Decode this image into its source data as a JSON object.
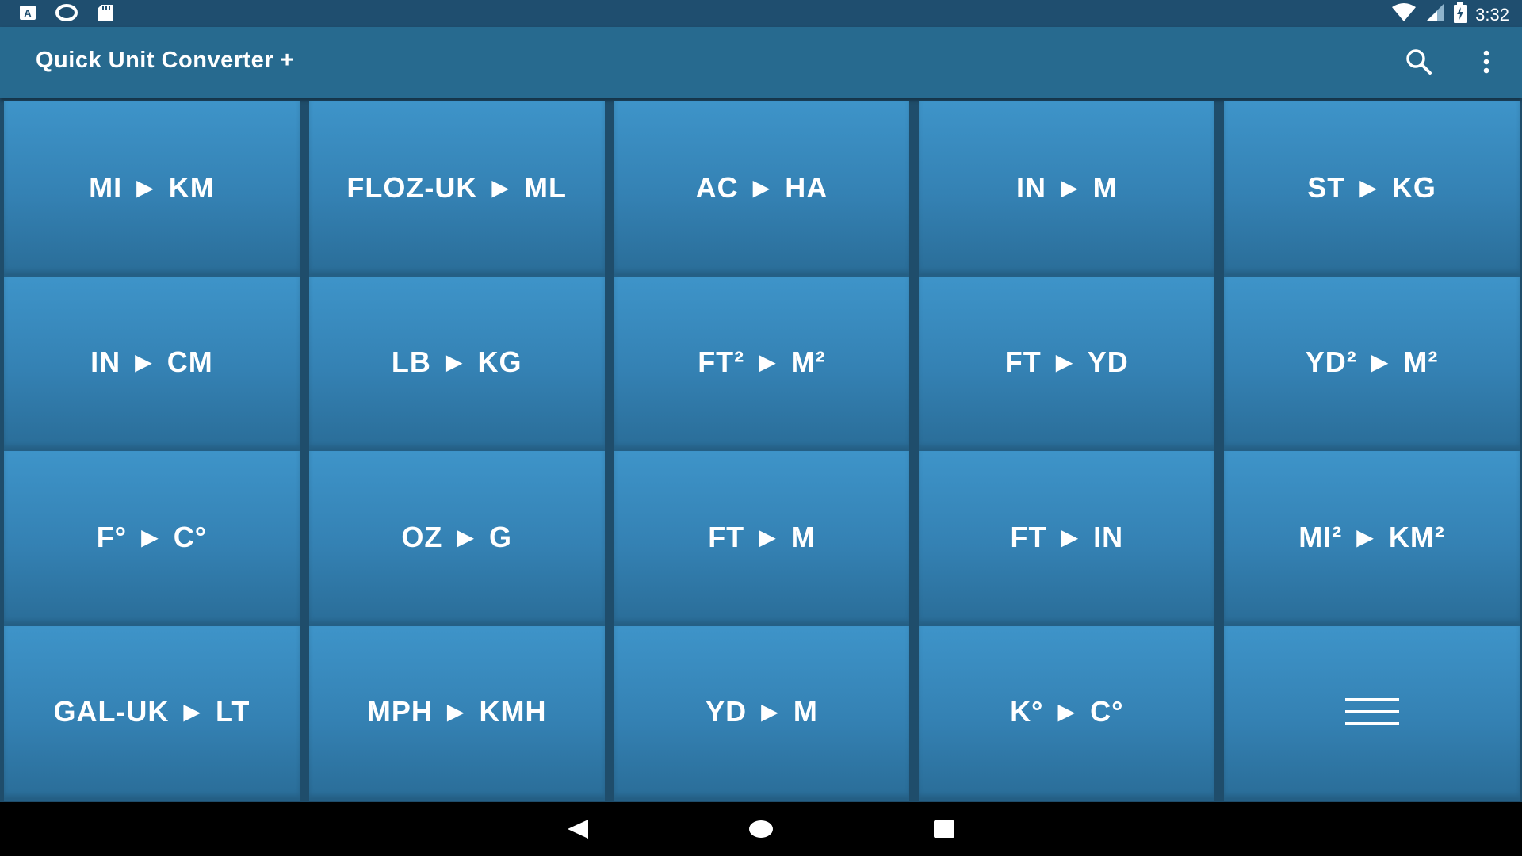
{
  "status_bar": {
    "time": "3:32",
    "left_icons": [
      "notification-a-icon",
      "sync-icon",
      "sd-card-icon"
    ],
    "right_icons": [
      "wifi-icon",
      "cell-signal-icon",
      "battery-charging-icon"
    ]
  },
  "app_bar": {
    "title": "Quick Unit Converter +",
    "actions": [
      "search-icon",
      "overflow-menu-icon"
    ]
  },
  "converters": [
    {
      "id": "mi-km",
      "label": "MI ► KM"
    },
    {
      "id": "floz-uk-ml",
      "label": "FLOZ-UK ► ML"
    },
    {
      "id": "ac-ha",
      "label": "AC ► HA"
    },
    {
      "id": "in-m",
      "label": "IN ► M"
    },
    {
      "id": "st-kg",
      "label": "ST ► KG"
    },
    {
      "id": "in-cm",
      "label": "IN ► CM"
    },
    {
      "id": "lb-kg",
      "label": "LB ► KG"
    },
    {
      "id": "ft2-m2",
      "label": "FT² ► M²"
    },
    {
      "id": "ft-yd",
      "label": "FT ► YD"
    },
    {
      "id": "yd2-m2",
      "label": "YD² ► M²"
    },
    {
      "id": "f-c",
      "label": "F° ► C°"
    },
    {
      "id": "oz-g",
      "label": "OZ ► G"
    },
    {
      "id": "ft-m",
      "label": "FT ► M"
    },
    {
      "id": "ft-in",
      "label": "FT ► IN"
    },
    {
      "id": "mi2-km2",
      "label": "MI² ► KM²"
    },
    {
      "id": "gal-uk-lt",
      "label": "GAL-UK ► LT"
    },
    {
      "id": "mph-kmh",
      "label": "MPH ► KMH"
    },
    {
      "id": "yd-m",
      "label": "YD ► M"
    },
    {
      "id": "k-c",
      "label": "K° ► C°"
    }
  ],
  "more_tile": {
    "icon": "hamburger-menu-icon"
  },
  "nav_bar": {
    "buttons": [
      "back-icon",
      "home-icon",
      "recents-icon"
    ]
  },
  "colors": {
    "status_bar": "#1f4e6f",
    "app_bar": "#276a8f",
    "tile_top": "#3e94c9",
    "tile_bottom": "#2a6d98",
    "nav_bar": "#000000",
    "text": "#ffffff"
  }
}
